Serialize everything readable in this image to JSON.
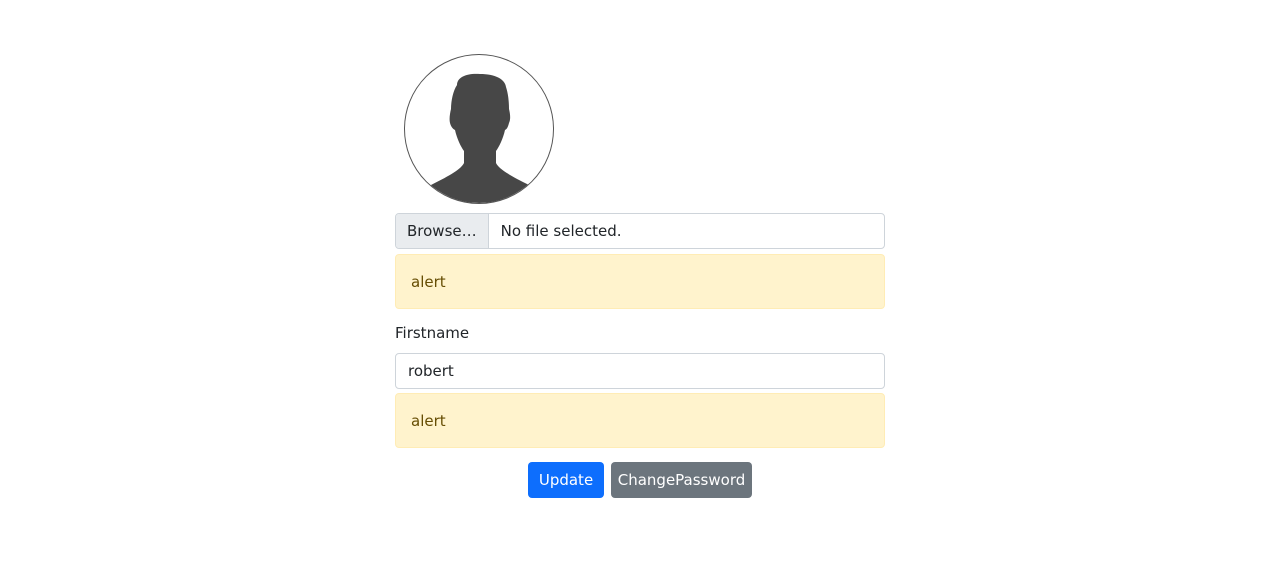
{
  "profile": {
    "avatar_icon": "user-silhouette-icon"
  },
  "file_upload": {
    "browse_label": "Browse…",
    "status_text": "No file selected."
  },
  "alerts": {
    "file_alert": "alert",
    "firstname_alert": "alert"
  },
  "firstname": {
    "label": "Firstname",
    "value": "robert"
  },
  "actions": {
    "update_label": "Update",
    "change_password_label": "ChangePassword"
  },
  "colors": {
    "primary": "#0d6efd",
    "secondary": "#6c757d",
    "alert_bg": "#fff3cd",
    "alert_text": "#664d03",
    "silhouette": "#474747"
  }
}
